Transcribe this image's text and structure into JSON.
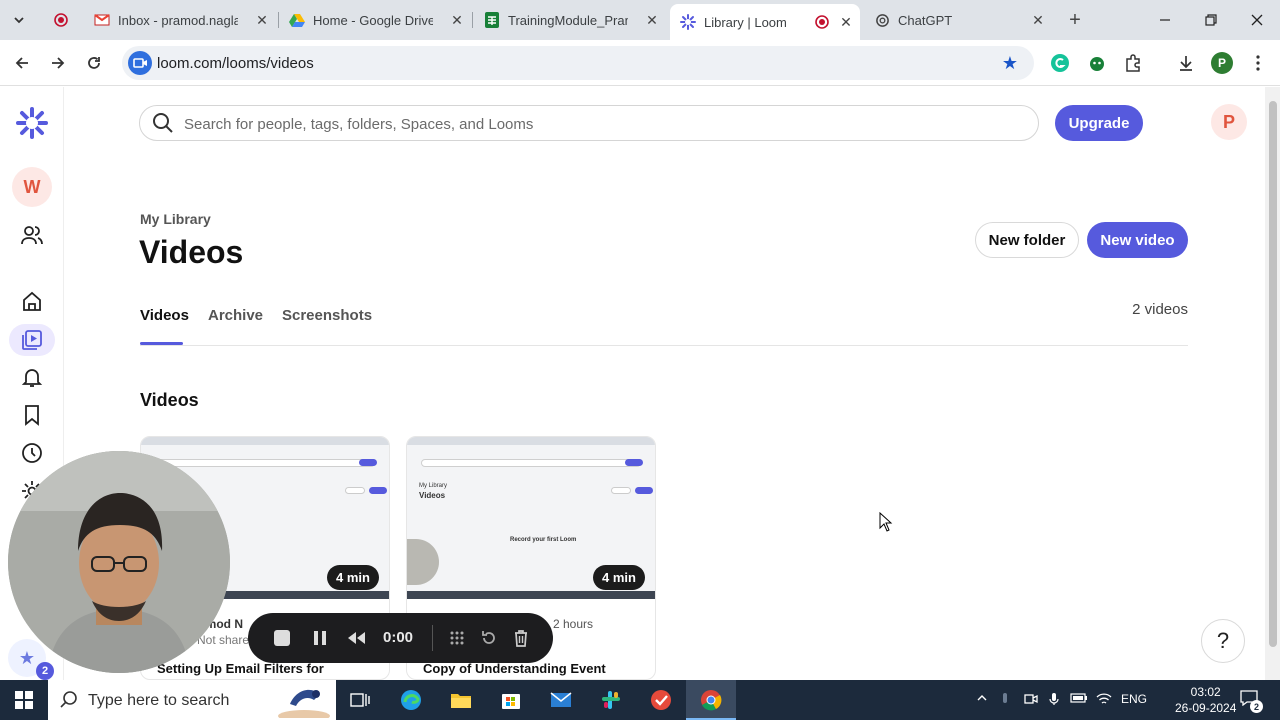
{
  "browser": {
    "tabs": [
      {
        "label": "Inbox - pramod.nagla@",
        "icon": "gmail-icon"
      },
      {
        "label": "Home - Google Drive",
        "icon": "drive-icon"
      },
      {
        "label": "TrainingModule_Pramo",
        "icon": "sheets-icon"
      },
      {
        "label": "Library | Loom",
        "icon": "loom-icon"
      },
      {
        "label": "ChatGPT",
        "icon": "chatgpt-icon"
      }
    ],
    "url": "loom.com/looms/videos",
    "profile_initial": "P"
  },
  "loom": {
    "workspace_initial": "W",
    "avatar_initial": "P",
    "notification_count": "2",
    "search_placeholder": "Search for people, tags, folders, Spaces, and Looms",
    "upgrade_label": "Upgrade",
    "breadcrumb": "My Library",
    "page_title": "Videos",
    "new_folder_label": "New folder",
    "new_video_label": "New video",
    "tabs": [
      "Videos",
      "Archive",
      "Screenshots"
    ],
    "video_count": "2 videos",
    "section_title": "Videos",
    "videos": [
      {
        "duration": "4 min",
        "owner": "amod N",
        "sharing": "Not share",
        "title": "Setting Up Email Filters for"
      },
      {
        "duration": "4 min",
        "age": "2 hours",
        "title": "Copy of Understanding Event"
      }
    ],
    "thumb_text": {
      "library": "My Library",
      "title": "Videos",
      "new_folder": "New folder",
      "new_video": "New video",
      "record": "Record your first Loom"
    }
  },
  "recorder": {
    "time": "0:00"
  },
  "taskbar": {
    "search_placeholder": "Type here to search",
    "language": "ENG",
    "time": "03:02",
    "date": "26-09-2024",
    "notification_count": "2"
  },
  "colors": {
    "accent": "#565add",
    "workspace_bg": "#fde8e5",
    "workspace_fg": "#e0553e"
  }
}
